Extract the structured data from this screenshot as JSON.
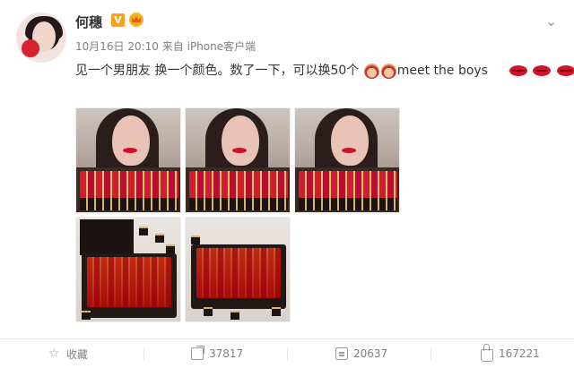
{
  "post": {
    "author": "何穗",
    "verified_badge": "V",
    "time": "10月16日 20:10",
    "source_prefix": "来自",
    "source": "iPhone客户端",
    "text": "见一个男朋友 换一个颜色。数了一下，可以换50个",
    "text_tail": "meet the boys",
    "icons": [
      "vip-badge",
      "crown-badge",
      "chevron-down-icon",
      "mom-emoji",
      "lips-emoji"
    ]
  },
  "actions": {
    "favorite_label": "收藏",
    "repost_count": "37817",
    "comment_count": "20637",
    "like_count": "167221"
  },
  "colors": {
    "text": "#333333",
    "meta": "#808080",
    "badge": "#f7a21c",
    "lipstick": "#d0102a"
  }
}
